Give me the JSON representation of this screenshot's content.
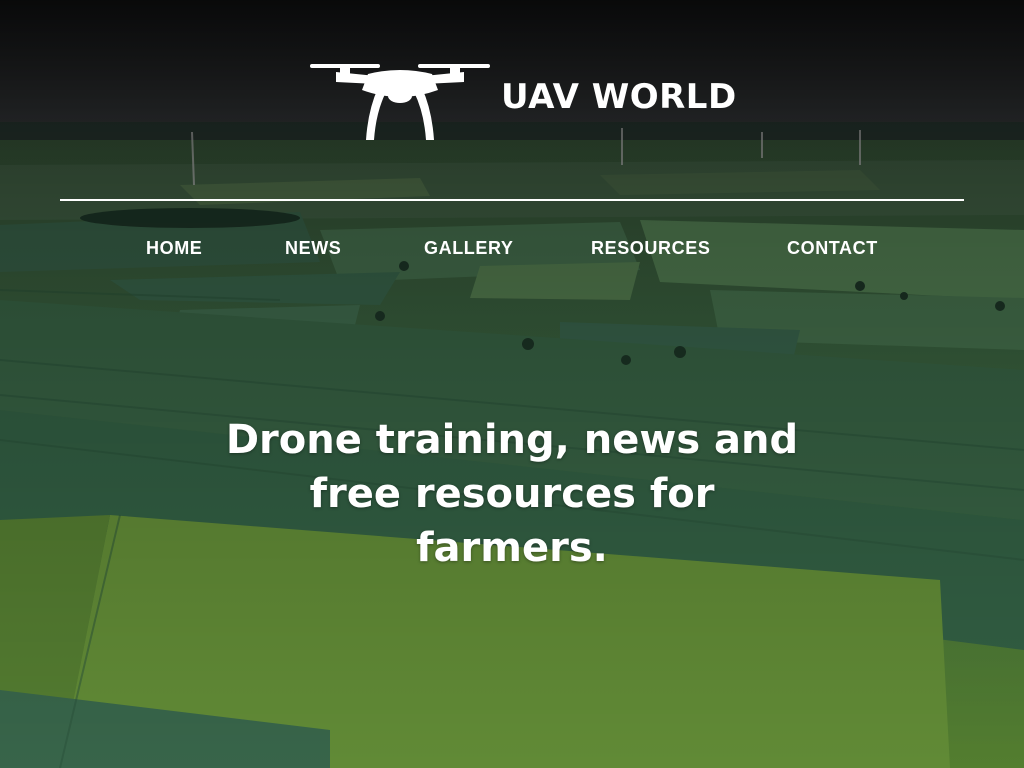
{
  "site": {
    "name": "UAV WORLD",
    "logo_icon": "drone-icon"
  },
  "nav": {
    "items": [
      {
        "label": "HOME"
      },
      {
        "label": "NEWS"
      },
      {
        "label": "GALLERY"
      },
      {
        "label": "RESOURCES"
      },
      {
        "label": "CONTACT"
      }
    ]
  },
  "hero": {
    "tagline": "Drone training, news and free resources for farmers.",
    "background": "aerial-farmland-photo"
  },
  "colors": {
    "text": "#ffffff",
    "sky": "#1c1e20",
    "field_dark": "#2f5a3a",
    "field_light": "#6f9a3c"
  }
}
